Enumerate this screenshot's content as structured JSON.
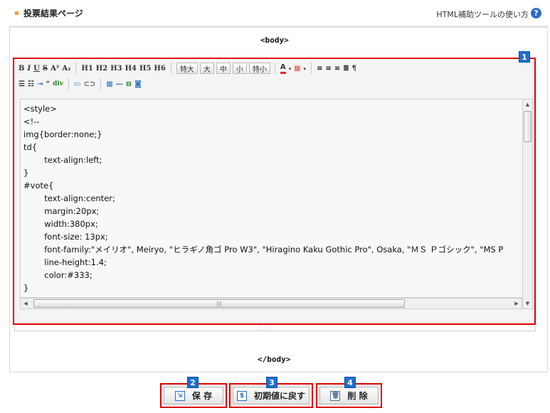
{
  "header": {
    "title": "投票結果ページ",
    "help_link": "HTML補助ツールの使い方",
    "help_icon_glyph": "?"
  },
  "tags": {
    "open": "<body>",
    "close": "</body>"
  },
  "toolbar": {
    "row1_format": [
      "B",
      "I",
      "U",
      "S",
      "A²",
      "A₂"
    ],
    "row1_headings": [
      "H1",
      "H2",
      "H3",
      "H4",
      "H5",
      "H6"
    ],
    "row1_sizes": [
      "特大",
      "大",
      "中",
      "小",
      "特小"
    ],
    "row1_misc_icons": [
      "font-color-icon",
      "bg-color-icon",
      "align-left-icon",
      "align-center-icon",
      "align-right-icon",
      "justify-icon",
      "paragraph-icon"
    ],
    "row2_icons": [
      "unordered-list-icon",
      "ordered-list-icon",
      "indent-icon",
      "quote-icon",
      "div-insert-icon",
      "image-icon",
      "link-icon",
      "table-icon",
      "horizontal-rule-icon",
      "pagebreak-icon",
      "object-icon"
    ]
  },
  "editor": {
    "code": "<style>\n<!--\nimg{border:none;}\ntd{\n\ttext-align:left;\n}\n#vote{\n\ttext-align:center;\n\tmargin:20px;\n\twidth:380px;\n\tfont-size: 13px;\n\tfont-family:\"メイリオ\", Meiryo, \"ヒラギノ角ゴ Pro W3\", \"Hiragino Kaku Gothic Pro\", Osaka, \"ＭＳ Ｐゴシック\", \"MS P\n\tline-height:1.4;\n\tcolor:#333;\n}\n#vote *{"
  },
  "badges": [
    "1",
    "2",
    "3",
    "4"
  ],
  "buttons": {
    "save": "保 存",
    "reset": "初期値に戻す",
    "delete": "削 除"
  },
  "colors": {
    "highlight": "#e00000",
    "badge": "#1a6fd1"
  }
}
